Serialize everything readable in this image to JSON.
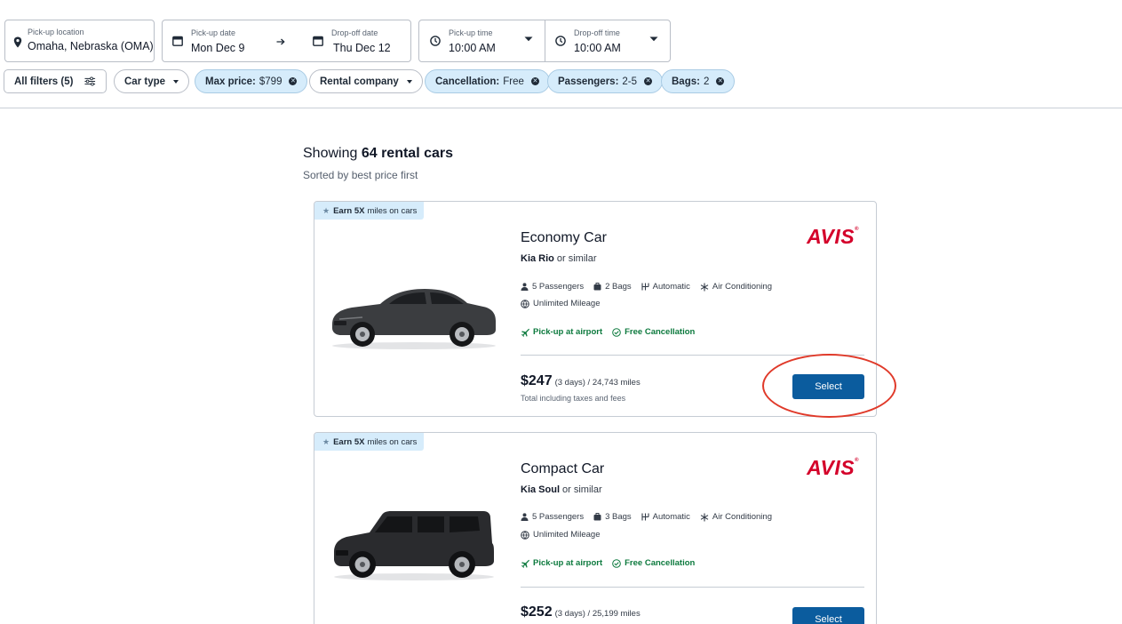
{
  "search": {
    "pickup_location": {
      "label": "Pick-up location",
      "value": "Omaha, Nebraska (OMA)"
    },
    "pickup_date": {
      "label": "Pick-up date",
      "value": "Mon Dec 9"
    },
    "dropoff_date": {
      "label": "Drop-off date",
      "value": "Thu Dec 12"
    },
    "pickup_time": {
      "label": "Pick-up time",
      "value": "10:00 AM"
    },
    "dropoff_time": {
      "label": "Drop-off time",
      "value": "10:00 AM"
    }
  },
  "filters": {
    "all_filters": "All filters (5)",
    "car_type": "Car type",
    "max_price_label": "Max price:",
    "max_price_value": "$799",
    "rental_company": "Rental company",
    "cancellation_label": "Cancellation:",
    "cancellation_value": "Free",
    "passengers_label": "Passengers:",
    "passengers_value": "2-5",
    "bags_label": "Bags:",
    "bags_value": "2"
  },
  "results": {
    "showing_prefix": "Showing",
    "count_text": "64 rental cars",
    "sort_note": "Sorted by best price first"
  },
  "cars": [
    {
      "earn_bold": "Earn 5X",
      "earn_rest": "miles on cars",
      "class": "Economy Car",
      "model": "Kia Rio",
      "similar": "or similar",
      "features": [
        "5 Passengers",
        "2 Bags",
        "Automatic",
        "Air Conditioning",
        "Unlimited Mileage"
      ],
      "perks": [
        "Pick-up at airport",
        "Free Cancellation"
      ],
      "vendor": "AVIS",
      "price": "$247",
      "price_meta": "(3 days) / 24,743 miles",
      "price_note": "Total including taxes and fees",
      "cta": "Select"
    },
    {
      "earn_bold": "Earn 5X",
      "earn_rest": "miles on cars",
      "class": "Compact Car",
      "model": "Kia Soul",
      "similar": "or similar",
      "features": [
        "5 Passengers",
        "3 Bags",
        "Automatic",
        "Air Conditioning",
        "Unlimited Mileage"
      ],
      "perks": [
        "Pick-up at airport",
        "Free Cancellation"
      ],
      "vendor": "AVIS",
      "price": "$252",
      "price_meta": "(3 days) / 25,199 miles",
      "cta": "Select"
    }
  ],
  "colors": {
    "primary_button": "#0b5c9e",
    "active_chip": "#d6ecfb",
    "perk_green": "#0d7a3e",
    "avis_red": "#d4002a",
    "annotation_red": "#e03a2a"
  }
}
